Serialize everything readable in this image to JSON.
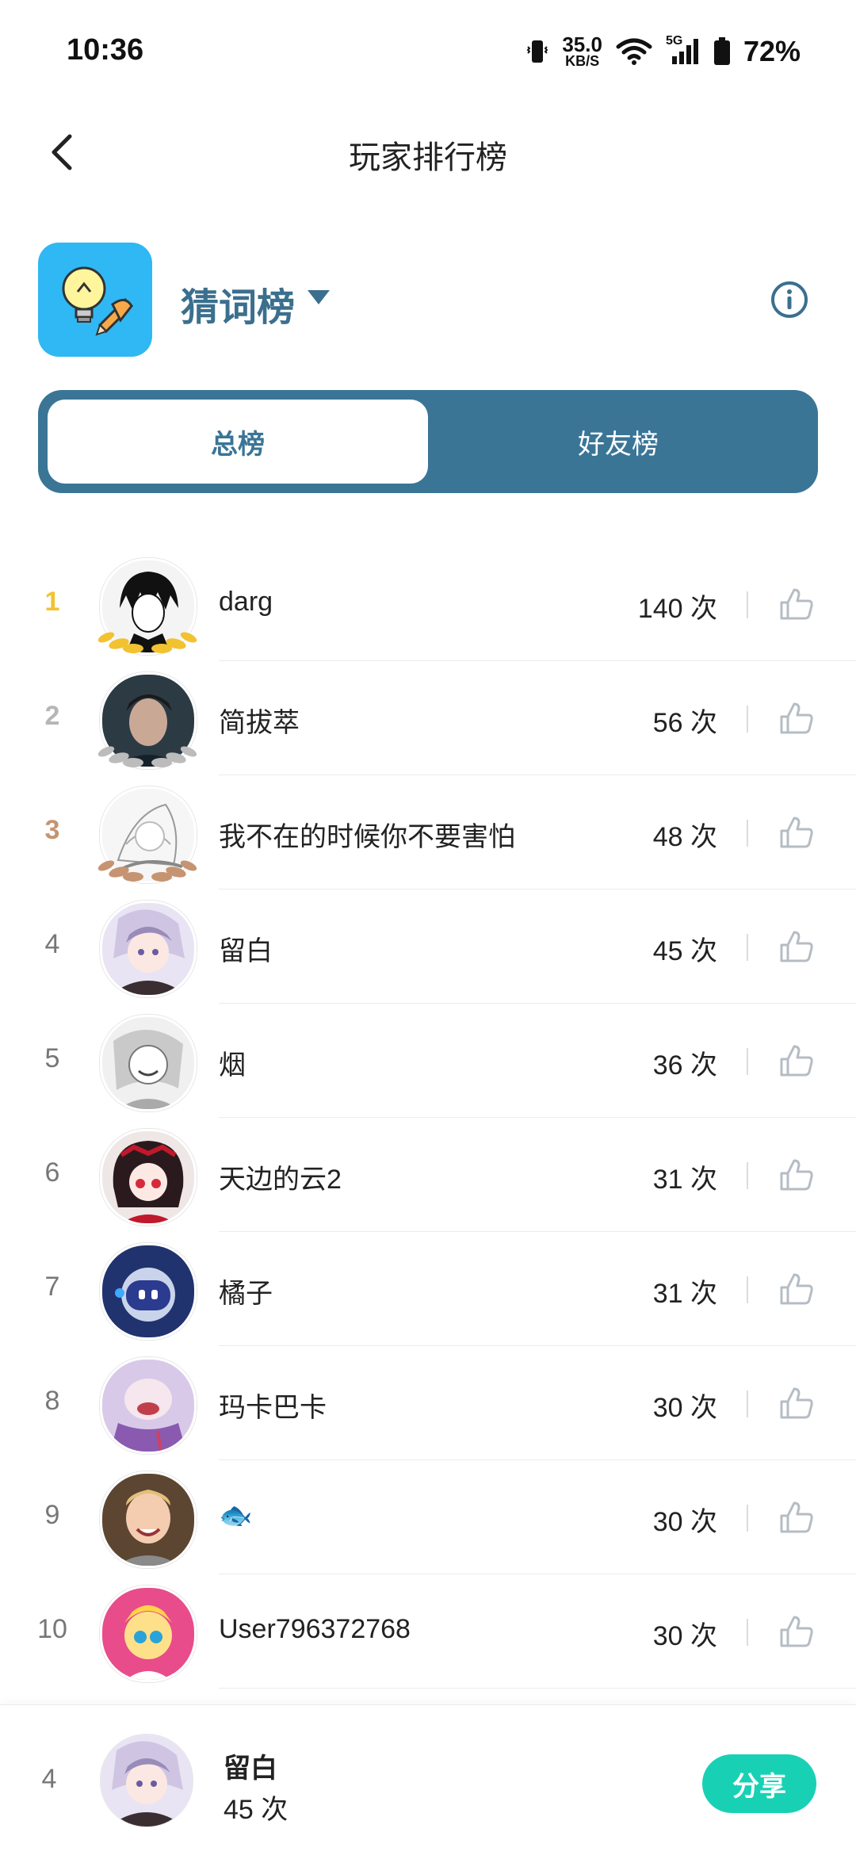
{
  "status_bar": {
    "time": "10:36",
    "net_speed": "35.0",
    "net_unit": "KB/S",
    "signal_label": "5G",
    "battery": "72%"
  },
  "header": {
    "title": "玩家排行榜"
  },
  "game": {
    "name": "猜词榜"
  },
  "tabs": {
    "total": "总榜",
    "friends": "好友榜"
  },
  "colors": {
    "primary": "#3a7596",
    "accent": "#18d1b5",
    "gold": "#f2c230",
    "silver": "#b6b6b6",
    "bronze": "#c69470"
  },
  "list": [
    {
      "rank": "1",
      "name": "darg",
      "score": "140 次"
    },
    {
      "rank": "2",
      "name": "简拔萃",
      "score": "56 次"
    },
    {
      "rank": "3",
      "name": "我不在的时候你不要害怕",
      "score": "48 次"
    },
    {
      "rank": "4",
      "name": "留白",
      "score": "45 次"
    },
    {
      "rank": "5",
      "name": "烟",
      "score": "36 次"
    },
    {
      "rank": "6",
      "name": "天边的云2",
      "score": "31 次"
    },
    {
      "rank": "7",
      "name": "橘子",
      "score": "31 次"
    },
    {
      "rank": "8",
      "name": "玛卡巴卡",
      "score": "30 次"
    },
    {
      "rank": "9",
      "name": "🐟",
      "score": "30 次"
    },
    {
      "rank": "10",
      "name": "User796372768",
      "score": "30 次"
    }
  ],
  "self": {
    "rank": "4",
    "name": "留白",
    "score": "45 次",
    "share_label": "分享"
  }
}
